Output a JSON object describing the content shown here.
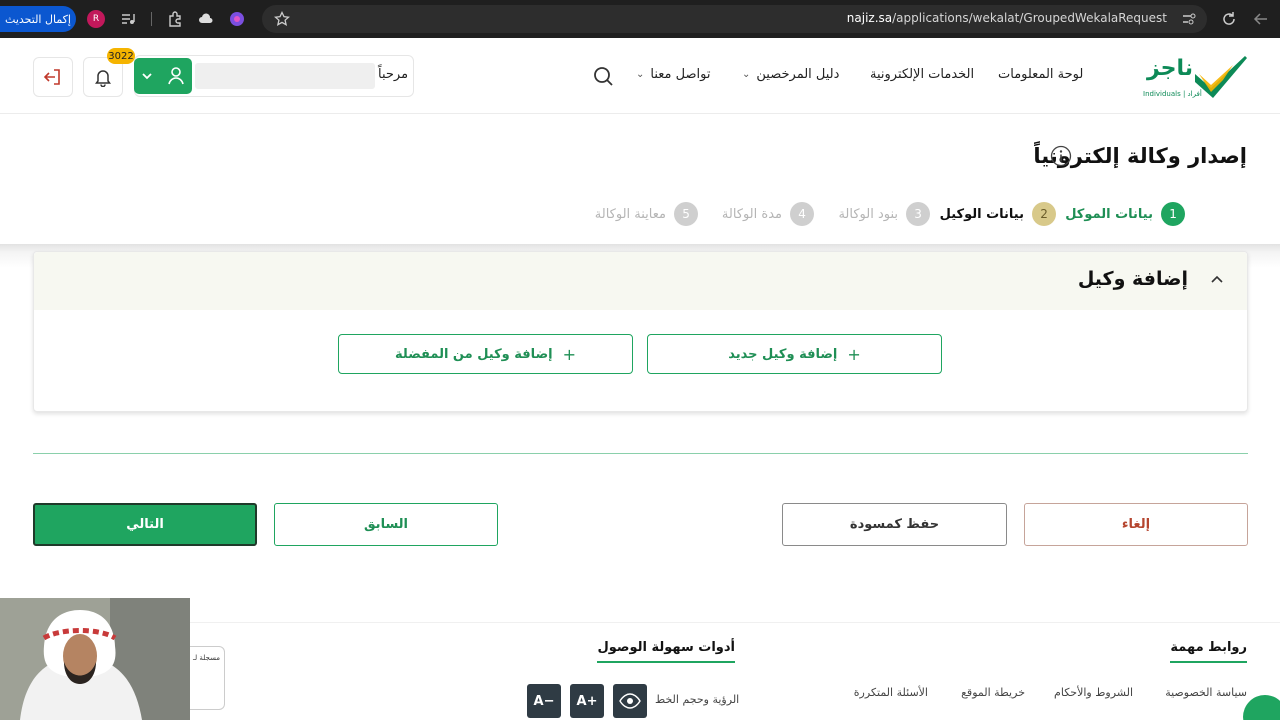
{
  "browser": {
    "update_button": "إكمال التحديث",
    "profile_initial": "R",
    "url_host": "najiz.sa",
    "url_path": "/applications/wekalat/GroupedWekalaRequest"
  },
  "header": {
    "logo_text": "ناجز",
    "logo_sub": "Individuals | أفراد",
    "nav": {
      "dashboard": "لوحة المعلومات",
      "eservices": "الخدمات الإلكترونية",
      "licensees_guide": "دليل المرخصين",
      "contact_us": "تواصل معنا"
    },
    "greeting": "مرحباً",
    "notification_count": "3022"
  },
  "page": {
    "title": "إصدار وكالة إلكترونياً",
    "steps": [
      {
        "num": "1",
        "label": "بيانات الموكل",
        "state": "done"
      },
      {
        "num": "2",
        "label": "بيانات الوكيل",
        "state": "current"
      },
      {
        "num": "3",
        "label": "بنود الوكالة",
        "state": "pending"
      },
      {
        "num": "4",
        "label": "مدة الوكالة",
        "state": "pending"
      },
      {
        "num": "5",
        "label": "معاينة الوكالة",
        "state": "pending"
      }
    ]
  },
  "card": {
    "title": "إضافة وكيل",
    "add_new_agent": "إضافة وكيل جديد",
    "add_from_favorites": "إضافة وكيل من المفضلة"
  },
  "actions": {
    "cancel": "إلغاء",
    "save_draft": "حفظ كمسودة",
    "previous": "السابق",
    "next": "التالي"
  },
  "footer": {
    "important_links_title": "روابط مهمة",
    "links": [
      "سياسة الخصوصية",
      "الشروط والأحكام",
      "خريطة الموقع",
      "الأسئلة المتكررة"
    ],
    "accessibility_title": "أدوات سهولة الوصول",
    "accessibility_label": "الرؤية وحجم الخط",
    "font_increase": "A+",
    "font_decrease": "A−",
    "cert_text": "مسجلة لـ"
  },
  "colors": {
    "brand_green": "#1fa560",
    "step_done": "#1fa560",
    "step_current": "#d8c98a",
    "step_pending": "#cfcfcf",
    "next_button": "#1fa560",
    "cancel_text": "#b5452f"
  }
}
